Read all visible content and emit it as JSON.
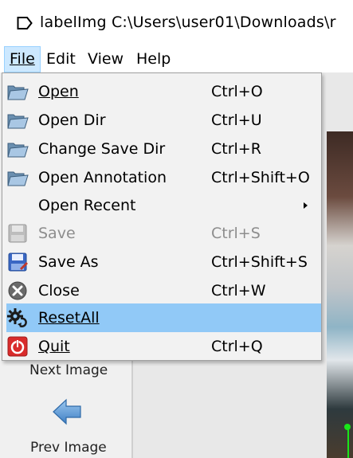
{
  "window": {
    "title": "labelImg C:\\Users\\user01\\Downloads\\r"
  },
  "menubar": {
    "items": [
      {
        "label": "File",
        "active": true
      },
      {
        "label": "Edit"
      },
      {
        "label": "View"
      },
      {
        "label": "Help"
      }
    ]
  },
  "tools": {
    "next_image": "Next Image",
    "prev_image": "Prev Image"
  },
  "file_menu": {
    "items": [
      {
        "label": "Open",
        "shortcut": "Ctrl+O",
        "icon": "open-folder-icon"
      },
      {
        "label": "Open Dir",
        "shortcut": "Ctrl+U",
        "icon": "open-folder-icon"
      },
      {
        "label": "Change Save Dir",
        "shortcut": "Ctrl+R",
        "icon": "open-folder-icon"
      },
      {
        "label": "Open Annotation",
        "shortcut": "Ctrl+Shift+O",
        "icon": "open-folder-icon"
      },
      {
        "label": "Open Recent",
        "shortcut": "",
        "submenu": true
      },
      {
        "label": "Save",
        "shortcut": "Ctrl+S",
        "icon": "save-icon",
        "disabled": true
      },
      {
        "label": "Save As",
        "shortcut": "Ctrl+Shift+S",
        "icon": "save-as-icon"
      },
      {
        "label": "Close",
        "shortcut": "Ctrl+W",
        "icon": "close-icon"
      },
      {
        "label": "ResetAll",
        "shortcut": "",
        "icon": "reset-gear-icon",
        "highlighted": true
      },
      {
        "label": "Quit",
        "shortcut": "Ctrl+Q",
        "icon": "quit-icon"
      }
    ]
  },
  "colors": {
    "menu_highlight": "#91c9f7",
    "menubar_active": "#cce8ff",
    "disabled_text": "#8d8d8d",
    "quit_red": "#d92b2b"
  }
}
